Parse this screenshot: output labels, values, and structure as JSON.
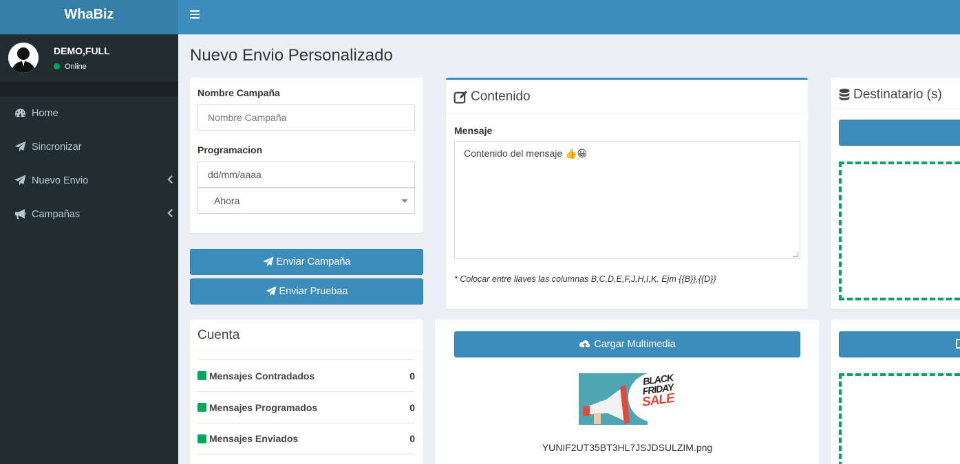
{
  "app": {
    "brand": "WhaBiz"
  },
  "user": {
    "name": "DEMO,FULL",
    "status": "Online"
  },
  "sidebar": {
    "items": [
      {
        "label": "Home",
        "icon": "dashboard-icon",
        "has_children": false
      },
      {
        "label": "Sincronizar",
        "icon": "paper-plane-icon",
        "has_children": false
      },
      {
        "label": "Nuevo Envio",
        "icon": "paper-plane-icon",
        "has_children": true
      },
      {
        "label": "Campañas",
        "icon": "bullhorn-icon",
        "has_children": true
      }
    ]
  },
  "page": {
    "title": "Nuevo Envio Personalizado"
  },
  "campaign_form": {
    "name_label": "Nombre Campaña",
    "name_placeholder": "Nombre Campaña",
    "schedule_label": "Programacion",
    "date_placeholder": "dd/mm/aaaa",
    "time_select_value": "Ahora"
  },
  "actions": {
    "send_campaign": "Enviar Campaña",
    "send_test": "Enviar Pruebaa"
  },
  "account": {
    "title": "Cuenta",
    "stats": [
      {
        "label": "Mensajes Contradados",
        "value": "0"
      },
      {
        "label": "Mensajes Programados",
        "value": "0"
      },
      {
        "label": "Mensajes Enviados",
        "value": "0"
      }
    ]
  },
  "content": {
    "title": "Contenido",
    "message_label": "Mensaje",
    "message_value": "Contenido del mensaje 👍😀",
    "hint": "* Colocar entre llaves las columnas B,C,D,E,F,J,H,I,K. Ejm {{B}},{{D}}",
    "upload_button": "Cargar Multimedia",
    "image_text": [
      "BLACK",
      "FRIDAY",
      "SALE"
    ],
    "filename": "YUNIF2UT35BT3HL7JSJDSULZIM.png"
  },
  "recipients": {
    "title": "Destinatario (s)"
  },
  "colors": {
    "primary": "#3c8dbc",
    "sidebar": "#222d32",
    "success": "#00a65a"
  }
}
